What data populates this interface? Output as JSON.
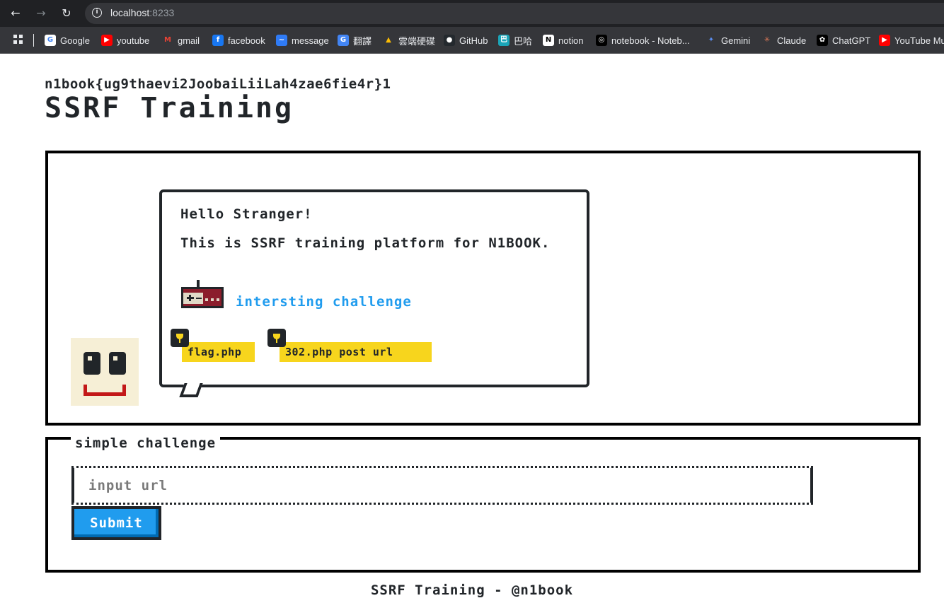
{
  "browser": {
    "url_host": "localhost",
    "url_port": ":8233",
    "back_icon": "arrow-left-icon",
    "forward_icon": "arrow-right-icon",
    "reload_icon": "reload-icon",
    "bookmarks": [
      {
        "label": "Google",
        "icon": "google-icon",
        "color": "#ffffff",
        "glyph": "G",
        "text_color": "#4285f4"
      },
      {
        "label": "youtube",
        "icon": "youtube-icon",
        "color": "#ff0000",
        "glyph": "▶",
        "text_color": "#ffffff"
      },
      {
        "label": "gmail",
        "icon": "gmail-icon",
        "color": "#35363a",
        "glyph": "M",
        "text_color": "#ea4335"
      },
      {
        "label": "facebook",
        "icon": "facebook-icon",
        "color": "#1877f2",
        "glyph": "f",
        "text_color": "#ffffff"
      },
      {
        "label": "message",
        "icon": "messenger-icon",
        "color": "#2f7bf6",
        "glyph": "~",
        "text_color": "#ffffff"
      },
      {
        "label": "翻譯",
        "icon": "translate-icon",
        "color": "#4285f4",
        "glyph": "G",
        "text_color": "#ffffff"
      },
      {
        "label": "雲端硬碟",
        "icon": "google-drive-icon",
        "color": "#35363a",
        "glyph": "▲",
        "text_color": "#fbbc04"
      },
      {
        "label": "GitHub",
        "icon": "github-icon",
        "color": "#24292e",
        "glyph": "●",
        "text_color": "#ffffff"
      },
      {
        "label": "巴哈",
        "icon": "bahamut-icon",
        "color": "#1ba5b8",
        "glyph": "巴",
        "text_color": "#ffffff"
      },
      {
        "label": "notion",
        "icon": "notion-icon",
        "color": "#ffffff",
        "glyph": "N",
        "text_color": "#000000"
      },
      {
        "label": "notebook - Noteb...",
        "icon": "notebooklm-icon",
        "color": "#000000",
        "glyph": "◎",
        "text_color": "#ffffff"
      },
      {
        "label": "Gemini",
        "icon": "gemini-icon",
        "color": "#35363a",
        "glyph": "✦",
        "text_color": "#5b8def"
      },
      {
        "label": "Claude",
        "icon": "claude-icon",
        "color": "#35363a",
        "glyph": "✳",
        "text_color": "#d97757"
      },
      {
        "label": "ChatGPT",
        "icon": "chatgpt-icon",
        "color": "#000000",
        "glyph": "✿",
        "text_color": "#ffffff"
      },
      {
        "label": "YouTube Mu",
        "icon": "youtube-music-icon",
        "color": "#ff0000",
        "glyph": "▶",
        "text_color": "#ffffff"
      }
    ]
  },
  "page": {
    "flag_text": "n1book{ug9thaevi2JoobaiLiiLah4zae6fie4r}1",
    "title": "SSRF Training",
    "greeting": "Hello Stranger!",
    "intro": "This is SSRF training platform for N1BOOK.",
    "challenge_link": "intersting challenge",
    "badges": [
      "flag.php",
      "302.php post url"
    ],
    "form_legend": "simple challenge",
    "input_placeholder": "input url",
    "input_value": "",
    "submit_label": "Submit",
    "footer": "SSRF Training - @n1book"
  },
  "colors": {
    "link": "#209cee",
    "badge": "#f7d51d",
    "button": "#209cee",
    "mouth": "#c31818",
    "face": "#f6efd6"
  }
}
